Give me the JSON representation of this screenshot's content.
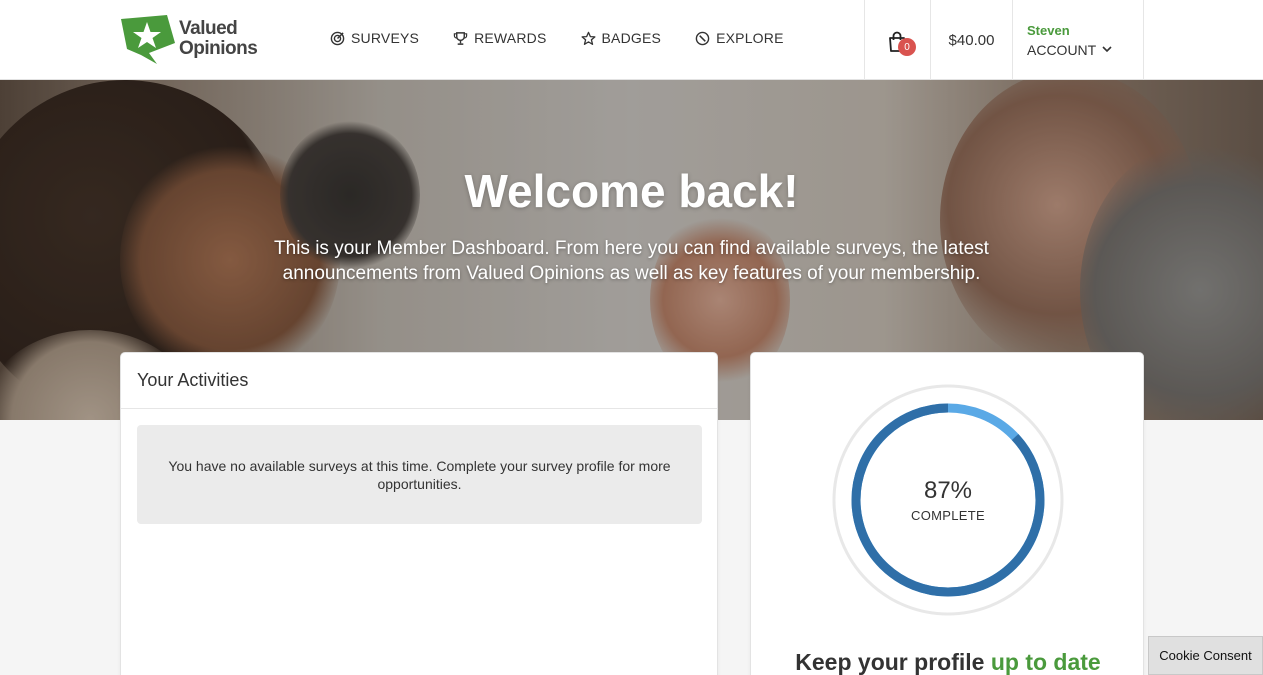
{
  "brand": {
    "line1": "Valued",
    "line2": "Opinions",
    "green": "#4a9a3c"
  },
  "nav": [
    {
      "icon": "target-icon",
      "label": "SURVEYS"
    },
    {
      "icon": "trophy-icon",
      "label": "REWARDS"
    },
    {
      "icon": "star-icon",
      "label": "BADGES"
    },
    {
      "icon": "compass-icon",
      "label": "EXPLORE"
    }
  ],
  "cart": {
    "count": "0"
  },
  "balance": "$40.00",
  "account": {
    "name": "Steven",
    "label": "ACCOUNT"
  },
  "hero": {
    "title": "Welcome back!",
    "subtitle": "This is your Member Dashboard. From here you can find available surveys, the latest announcements from Valued Opinions as well as key features of your membership."
  },
  "activities": {
    "title": "Your Activities",
    "message": "You have no available surveys at this time. Complete your survey profile for more opportunities."
  },
  "profile": {
    "percent": "87%",
    "progress": 0.87,
    "label": "COMPLETE",
    "title_start": "Keep your profile ",
    "title_highlight": "up to date"
  },
  "cookie": "Cookie Consent"
}
